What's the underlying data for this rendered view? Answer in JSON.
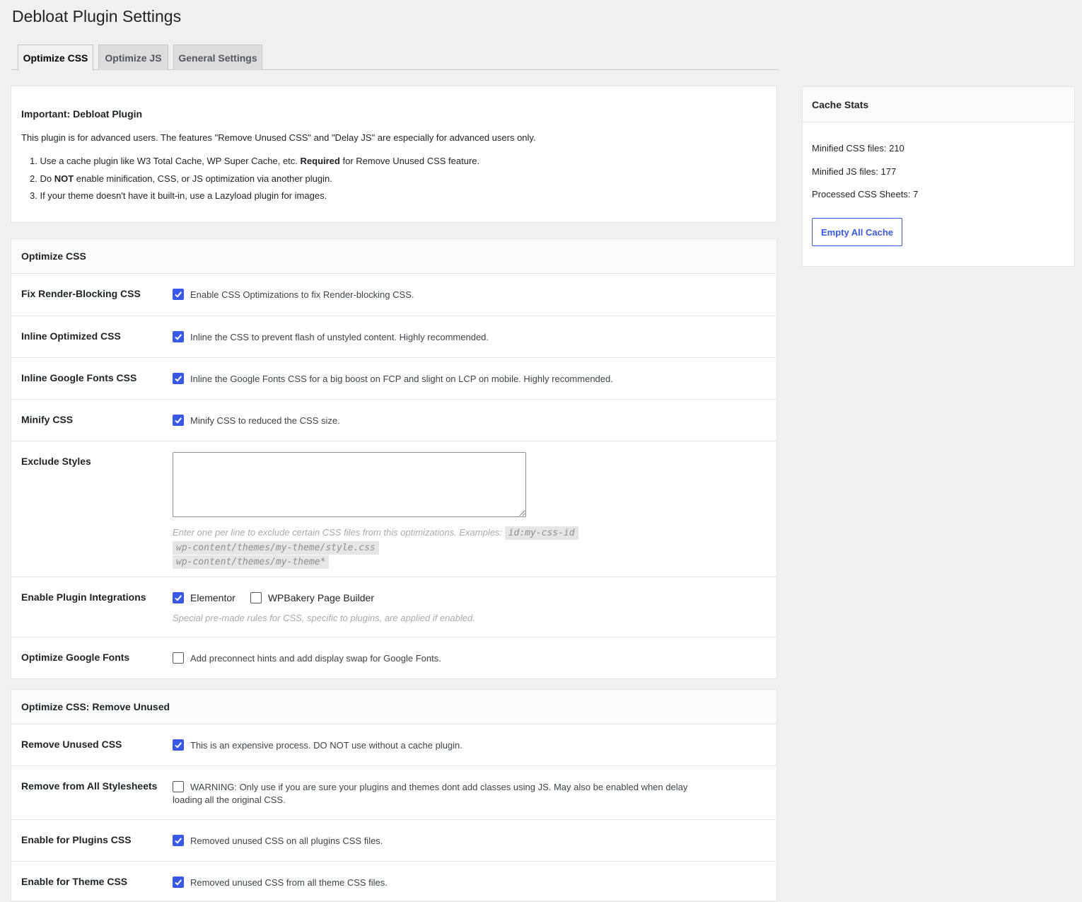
{
  "page": {
    "title": "Debloat Plugin Settings"
  },
  "tabs": [
    {
      "label": "Optimize CSS",
      "active": true
    },
    {
      "label": "Optimize JS",
      "active": false
    },
    {
      "label": "General Settings",
      "active": false
    }
  ],
  "notice": {
    "title": "Important: Debloat Plugin",
    "intro": "This plugin is for advanced users. The features \"Remove Unused CSS\" and \"Delay JS\" are especially for advanced users only.",
    "items": [
      {
        "num": "1.",
        "pre": "Use a cache plugin like W3 Total Cache, WP Super Cache, etc. ",
        "bold": "Required",
        "post": " for Remove Unused CSS feature."
      },
      {
        "num": "2.",
        "pre": "Do ",
        "bold": "NOT",
        "post": " enable minification, CSS, or JS optimization via another plugin."
      },
      {
        "num": "3.",
        "pre": "If your theme doesn't have it built-in, use a Lazyload plugin for images.",
        "bold": "",
        "post": ""
      }
    ]
  },
  "optimize_css": {
    "heading": "Optimize CSS",
    "fix_render_blocking": {
      "label": "Fix Render-Blocking CSS",
      "checked": true,
      "text": "Enable CSS Optimizations to fix Render-blocking CSS."
    },
    "inline_optimized": {
      "label": "Inline Optimized CSS",
      "checked": true,
      "text": "Inline the CSS to prevent flash of unstyled content. Highly recommended."
    },
    "inline_google_fonts": {
      "label": "Inline Google Fonts CSS",
      "checked": true,
      "text": "Inline the Google Fonts CSS for a big boost on FCP and slight on LCP on mobile. Highly recommended."
    },
    "minify": {
      "label": "Minify CSS",
      "checked": true,
      "text": "Minify CSS to reduced the CSS size."
    },
    "exclude_styles": {
      "label": "Exclude Styles",
      "value": "",
      "desc": "Enter one per line to exclude certain CSS files from this optimizations. Examples:",
      "examples": [
        "id:my-css-id",
        "wp-content/themes/my-theme/style.css",
        "wp-content/themes/my-theme*"
      ]
    },
    "integrations": {
      "label": "Enable Plugin Integrations",
      "options": [
        {
          "label": "Elementor",
          "checked": true
        },
        {
          "label": "WPBakery Page Builder",
          "checked": false
        }
      ],
      "desc": "Special pre-made rules for CSS, specific to plugins, are applied if enabled."
    },
    "google_fonts": {
      "label": "Optimize Google Fonts",
      "checked": false,
      "text": "Add preconnect hints and add display swap for Google Fonts."
    }
  },
  "remove_unused": {
    "heading": "Optimize CSS: Remove Unused",
    "remove_unused_css": {
      "label": "Remove Unused CSS",
      "checked": true,
      "text": "This is an expensive process. DO NOT use without a cache plugin."
    },
    "all_stylesheets": {
      "label": "Remove from All Stylesheets",
      "checked": false,
      "text_line1": "WARNING: Only use if you are sure your plugins and themes dont add classes using JS. May also be enabled when delay",
      "text_line2": "loading all the original CSS."
    },
    "plugins_css": {
      "label": "Enable for Plugins CSS",
      "checked": true,
      "text": "Removed unused CSS on all plugins CSS files."
    },
    "theme_css": {
      "label": "Enable for Theme CSS",
      "checked": true,
      "text": "Removed unused CSS from all theme CSS files."
    }
  },
  "cache_stats": {
    "heading": "Cache Stats",
    "css_files": "Minified CSS files: 210",
    "js_files": "Minified JS files: 177",
    "processed_sheets": "Processed CSS Sheets: 7",
    "empty_button": "Empty All Cache"
  },
  "colors": {
    "accent": "#3858e9",
    "background": "#f0f0f1",
    "panel": "#ffffff"
  },
  "icons": {
    "checkbox_checked": "checkmark-icon"
  }
}
